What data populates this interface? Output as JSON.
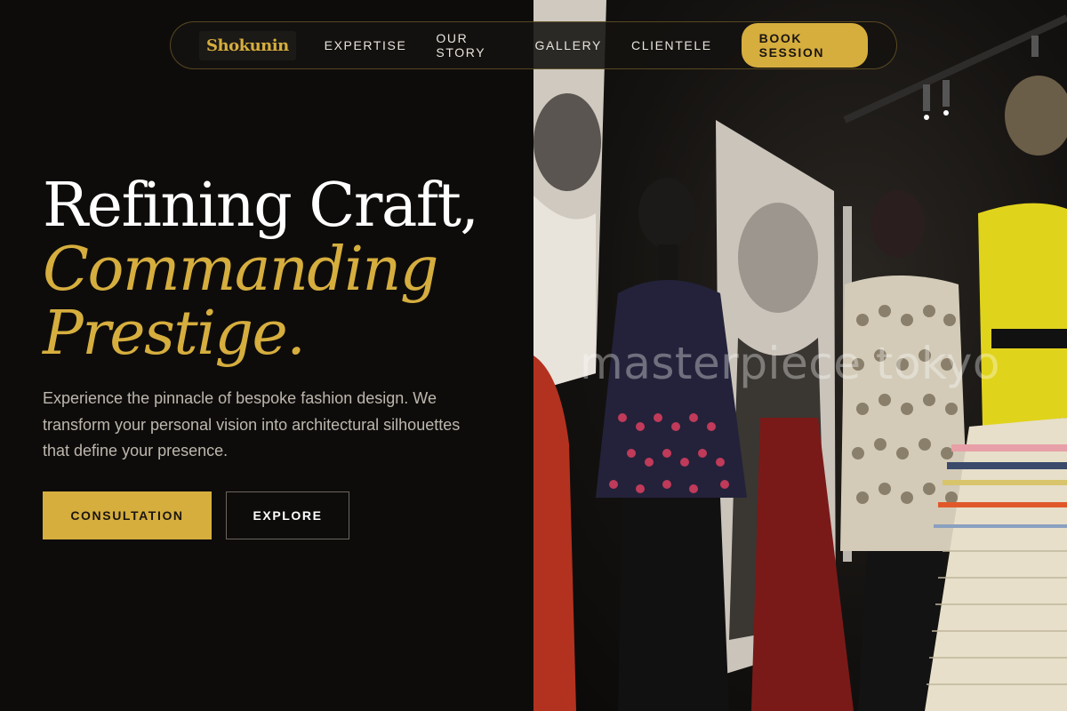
{
  "nav": {
    "logo": "Shokunin",
    "links": [
      "EXPERTISE",
      "OUR STORY",
      "GALLERY",
      "CLIENTELE"
    ],
    "cta": "BOOK SESSION"
  },
  "hero": {
    "line1": "Refining Craft,",
    "line2": "Commanding",
    "line3": "Prestige.",
    "description": "Experience the pinnacle of bespoke fashion design. We transform your personal vision into architectural silhouettes that define your presence.",
    "primary_button": "CONSULTATION",
    "secondary_button": "EXPLORE"
  },
  "image": {
    "watermark": "masterpiece tokyo"
  },
  "colors": {
    "accent": "#d6ae3e",
    "background": "#0e0c0b",
    "text_muted": "#bdb7ad"
  }
}
